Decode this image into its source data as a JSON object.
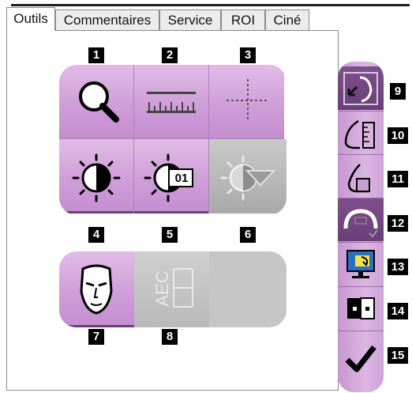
{
  "tabs": [
    {
      "label": "Outils",
      "active": true
    },
    {
      "label": "Commentaires",
      "active": false
    },
    {
      "label": "Service",
      "active": false
    },
    {
      "label": "ROI",
      "active": false
    },
    {
      "label": "Ciné",
      "active": false
    }
  ],
  "tools_row1": [
    {
      "num": "1",
      "icon": "magnifier-icon"
    },
    {
      "num": "2",
      "icon": "ruler-icon"
    },
    {
      "num": "3",
      "icon": "crosshair-icon"
    }
  ],
  "tools_row2": [
    {
      "num": "4",
      "icon": "contrast-icon"
    },
    {
      "num": "5",
      "icon": "contrast-preset-icon",
      "badge": "01"
    },
    {
      "num": "6",
      "icon": "contrast-dropdown-icon"
    }
  ],
  "tools_row3": [
    {
      "num": "7",
      "icon": "face-icon"
    },
    {
      "num": "8",
      "icon": "aec-icon",
      "text": "AEC"
    }
  ],
  "toolbar": [
    {
      "num": "9",
      "icon": "flip-icon"
    },
    {
      "num": "10",
      "icon": "breast-measure-icon"
    },
    {
      "num": "11",
      "icon": "breast-icon"
    },
    {
      "num": "12",
      "icon": "compression-icon"
    },
    {
      "num": "13",
      "icon": "monitor-swap-icon"
    },
    {
      "num": "14",
      "icon": "dual-view-icon"
    },
    {
      "num": "15",
      "icon": "checkmark-icon"
    }
  ],
  "colors": {
    "accent": "#cf9ed8",
    "accent_dark": "#6a3f78",
    "disabled": "#b5b5b5"
  }
}
